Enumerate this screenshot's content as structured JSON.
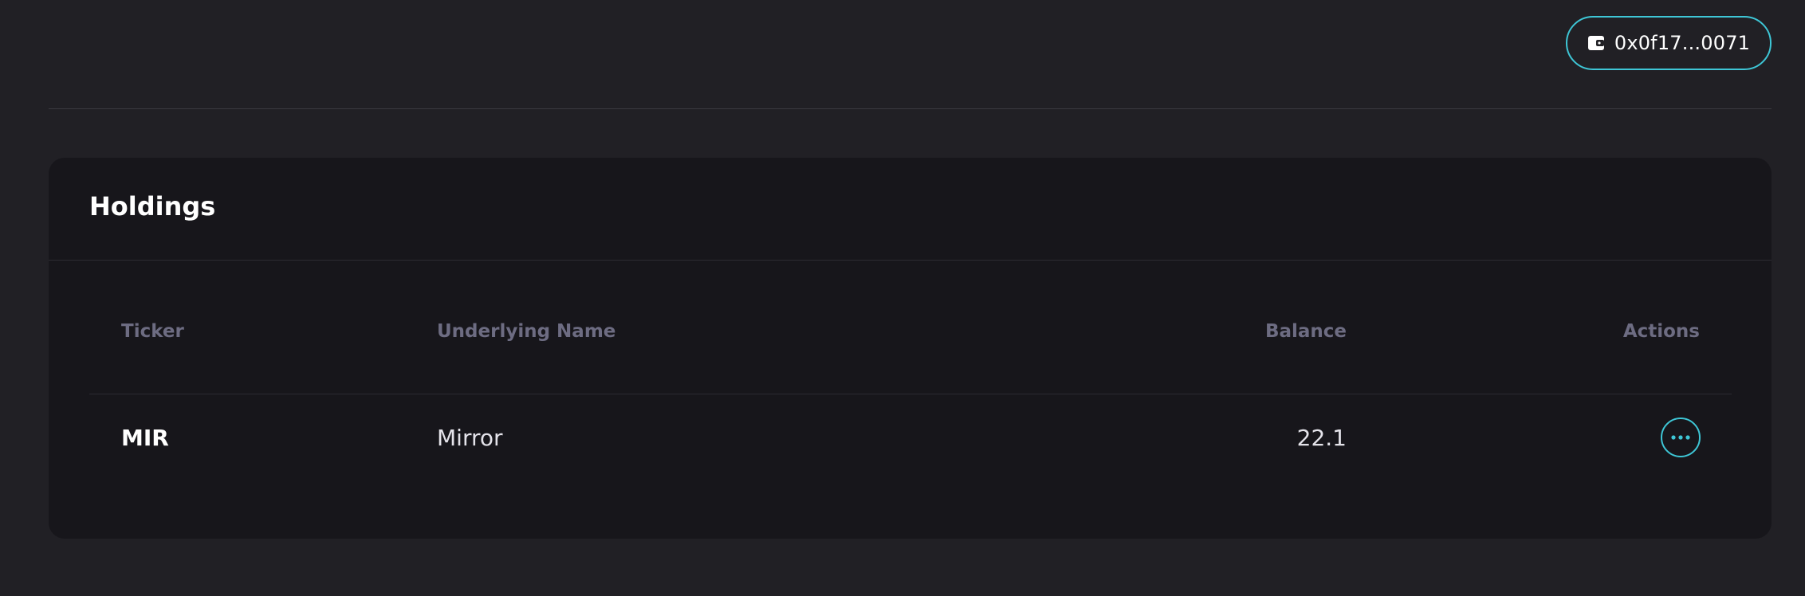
{
  "header": {
    "wallet": {
      "label": "0x0f17...0071",
      "icon": "wallet-icon"
    }
  },
  "holdings": {
    "title": "Holdings",
    "columns": {
      "ticker": "Ticker",
      "name": "Underlying Name",
      "balance": "Balance",
      "actions": "Actions"
    },
    "rows": [
      {
        "ticker": "MIR",
        "name": "Mirror",
        "balance": "22.1",
        "action_icon": "more-horizontal-icon"
      }
    ]
  },
  "colors": {
    "background": "#212025",
    "card": "#17161b",
    "accent": "#3ec6d6",
    "header_text": "#6d6c82"
  }
}
